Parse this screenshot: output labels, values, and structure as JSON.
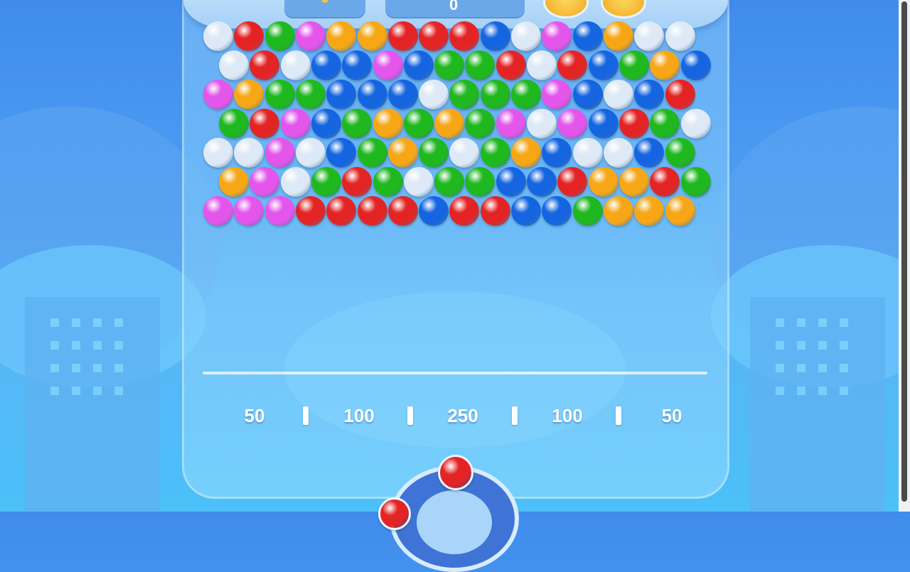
{
  "colors": {
    "red": "#e42424",
    "green": "#1fb81f",
    "blue": "#1565e0",
    "yellow": "#f7a716",
    "magenta": "#e455ec",
    "white": "#dde9f6"
  },
  "top_bar": {
    "score": "0",
    "icons": [
      "key-icon",
      "trophy-icon",
      "coin-icon"
    ]
  },
  "bubble_rows": [
    [
      "white",
      "red",
      "green",
      "magenta",
      "yellow",
      "yellow",
      "red",
      "red",
      "red",
      "blue",
      "white",
      "magenta",
      "blue",
      "yellow",
      "white",
      "white"
    ],
    [
      "white",
      "red",
      "white",
      "blue",
      "blue",
      "magenta",
      "blue",
      "green",
      "green",
      "red",
      "white",
      "red",
      "blue",
      "green",
      "yellow",
      "blue"
    ],
    [
      "magenta",
      "yellow",
      "green",
      "green",
      "blue",
      "blue",
      "blue",
      "white",
      "green",
      "green",
      "green",
      "magenta",
      "blue",
      "white",
      "blue",
      "red"
    ],
    [
      "green",
      "red",
      "magenta",
      "blue",
      "green",
      "yellow",
      "green",
      "yellow",
      "green",
      "magenta",
      "white",
      "magenta",
      "blue",
      "red",
      "green",
      "white"
    ],
    [
      "white",
      "white",
      "magenta",
      "white",
      "blue",
      "green",
      "yellow",
      "green",
      "white",
      "green",
      "yellow",
      "blue",
      "white",
      "white",
      "blue",
      "green"
    ],
    [
      "yellow",
      "magenta",
      "white",
      "green",
      "red",
      "green",
      "white",
      "green",
      "green",
      "blue",
      "blue",
      "red",
      "yellow",
      "yellow",
      "red",
      "green"
    ],
    [
      "magenta",
      "magenta",
      "magenta",
      "red",
      "red",
      "red",
      "red",
      "blue",
      "red",
      "red",
      "blue",
      "blue",
      "green",
      "yellow",
      "yellow",
      "yellow"
    ]
  ],
  "score_slots": [
    "50",
    "100",
    "250",
    "100",
    "50"
  ],
  "shooter": {
    "current_bubble": "red",
    "next_bubble": "red"
  }
}
